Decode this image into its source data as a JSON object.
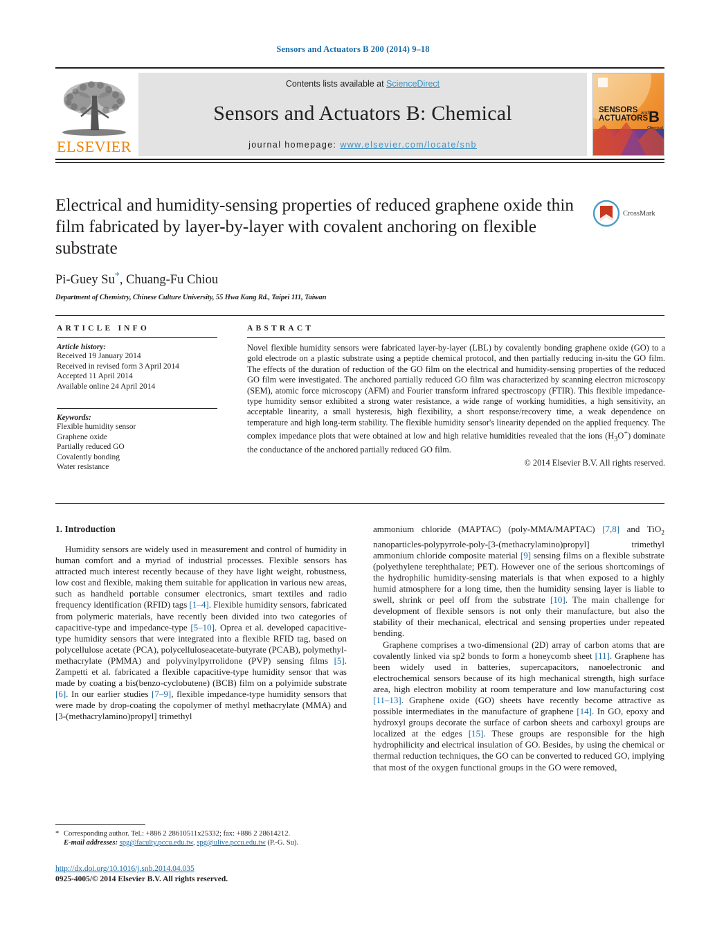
{
  "running_head": "Sensors and Actuators B 200 (2014) 9–18",
  "masthead": {
    "contents_prefix": "Contents lists available at ",
    "sciencedirect": "ScienceDirect",
    "journal_name": "Sensors and Actuators B: Chemical",
    "homepage_prefix": "journal homepage: ",
    "homepage_url": "www.elsevier.com/locate/snb",
    "publisher": "ELSEVIER",
    "cover": {
      "line1": "SENSORS",
      "line1_small": "and",
      "line2": "ACTUATORS",
      "letter": "B",
      "sub": "Chemical"
    },
    "link_color": "#3c92c4",
    "band_color": "#e3e3e3"
  },
  "title_block": {
    "title": "Electrical and humidity-sensing properties of reduced graphene oxide thin film fabricated by layer-by-layer with covalent anchoring on flexible substrate",
    "authors": "Pi-Guey Su",
    "authors_rest": ", Chuang-Fu Chiou",
    "corresponding_marker": "*",
    "affiliation": "Department of Chemistry, Chinese Culture University, 55 Hwa Kang Rd., Taipei 111, Taiwan",
    "crossmark_label": "CrossMark"
  },
  "article_info": {
    "heading": "ARTICLE INFO",
    "history_label": "Article history:",
    "history": [
      "Received 19 January 2014",
      "Received in revised form 3 April 2014",
      "Accepted 11 April 2014",
      "Available online 24 April 2014"
    ],
    "keywords_label": "Keywords:",
    "keywords": [
      "Flexible humidity sensor",
      "Graphene oxide",
      "Partially reduced GO",
      "Covalently bonding",
      "Water resistance"
    ]
  },
  "abstract": {
    "heading": "ABSTRACT",
    "text": "Novel flexible humidity sensors were fabricated layer-by-layer (LBL) by covalently bonding graphene oxide (GO) to a gold electrode on a plastic substrate using a peptide chemical protocol, and then partially reducing in-situ the GO film. The effects of the duration of reduction of the GO film on the electrical and humidity-sensing properties of the reduced GO film were investigated. The anchored partially reduced GO film was characterized by scanning electron microscopy (SEM), atomic force microscopy (AFM) and Fourier transform infrared spectroscopy (FTIR). This flexible impedance-type humidity sensor exhibited a strong water resistance, a wide range of working humidities, a high sensitivity, an acceptable linearity, a small hysteresis, high flexibility, a short response/recovery time, a weak dependence on temperature and high long-term stability. The flexible humidity sensor's linearity depended on the applied frequency. The complex impedance plots that were obtained at low and high relative humidities revealed that the ions (H",
    "text_sub": "3",
    "text_after_sub": "O",
    "text_sup": "+",
    "text_tail": ") dominate the conductance of the anchored partially reduced GO film.",
    "copyright": "© 2014 Elsevier B.V. All rights reserved."
  },
  "body": {
    "section_number_title": "1.  Introduction",
    "left_p1_a": "Humidity sensors are widely used in measurement and control of humidity in human comfort and a myriad of industrial processes. Flexible sensors has attracted much interest recently because of they have light weight, robustness, low cost and flexible, making them suitable for application in various new areas, such as handheld portable consumer electronics, smart textiles and radio frequency identification (RFID) tags ",
    "ref_1_4": "[1–4]",
    "left_p1_b": ". Flexible humidity sensors, fabricated from polymeric materials, have recently been divided into two categories of capacitive-type and impedance-type ",
    "ref_5_10": "[5–10]",
    "left_p1_c": ". Oprea et al. developed capacitive-type humidity sensors that were integrated into a flexible RFID tag, based on polycellulose acetate (PCA), polycelluloseacetate-butyrate (PCAB), polymethyl-methacrylate (PMMA) and polyvinylpyrrolidone (PVP) sensing films ",
    "ref_5": "[5]",
    "left_p1_d": ". Zampetti et al. fabricated a flexible capacitive-type humidity sensor that was made by coating a bis(benzo-cyclobutene) (BCB) film on a polyimide substrate ",
    "ref_6": "[6]",
    "left_p1_e": ". In our earlier studies ",
    "ref_7_9": "[7–9]",
    "left_p1_f": ", flexible impedance-type humidity sensors that were made by drop-coating the copolymer of methyl methacrylate (MMA) and [3-(methacrylamino)propyl] trimethyl",
    "right_p1_a": "ammonium chloride (MAPTAC) (poly-MMA/MAPTAC) ",
    "ref_7_8": "[7,8]",
    "right_p1_b": " and TiO",
    "right_p1_sub": "2",
    "right_p1_c": " nanoparticles-polypyrrole-poly-[3-(methacrylamino)propyl] trimethyl ammonium chloride composite material ",
    "ref_9": "[9]",
    "right_p1_d": " sensing films on a flexible substrate (polyethylene terephthalate; PET). However one of the serious shortcomings of the hydrophilic humidity-sensing materials is that when exposed to a highly humid atmosphere for a long time, then the humidity sensing layer is liable to swell, shrink or peel off from the substrate ",
    "ref_10": "[10]",
    "right_p1_e": ". The main challenge for development of flexible sensors is not only their manufacture, but also the stability of their mechanical, electrical and sensing properties under repeated bending.",
    "right_p2_a": "Graphene comprises a two-dimensional (2D) array of carbon atoms that are covalently linked via sp2 bonds to form a honeycomb sheet ",
    "ref_11": "[11]",
    "right_p2_b": ". Graphene has been widely used in batteries, supercapacitors, nanoelectronic and electrochemical sensors because of its high mechanical strength, high surface area, high electron mobility at room temperature and low manufacturing cost ",
    "ref_11_13": "[11–13]",
    "right_p2_c": ". Graphene oxide (GO) sheets have recently become attractive as possible intermediates in the manufacture of graphene ",
    "ref_14": "[14]",
    "right_p2_d": ". In GO, epoxy and hydroxyl groups decorate the surface of carbon sheets and carboxyl groups are localized at the edges ",
    "ref_15": "[15]",
    "right_p2_e": ". These groups are responsible for the high hydrophilicity and electrical insulation of GO. Besides, by using the chemical or thermal reduction techniques, the GO can be converted to reduced GO, implying that most of the oxygen functional groups in the GO were removed,"
  },
  "footnote": {
    "marker": "*",
    "text_a": " Corresponding author. Tel.: +886 2 28610511x25332; fax: +886 2 28614212.",
    "label": "E-mail addresses:",
    "email1": "spg@faculty.pccu.edu.tw",
    "sep": ", ",
    "email2": "spg@ulive.pccu.edu.tw",
    "suffix": " (P.-G. Su)."
  },
  "footer": {
    "doi": "http://dx.doi.org/10.1016/j.snb.2014.04.035",
    "issn": "0925-4005/© 2014 Elsevier B.V. All rights reserved."
  },
  "colors": {
    "link": "#1a6ca8",
    "sd_link": "#3c92c4",
    "elsevier_orange": "#ef8200"
  }
}
